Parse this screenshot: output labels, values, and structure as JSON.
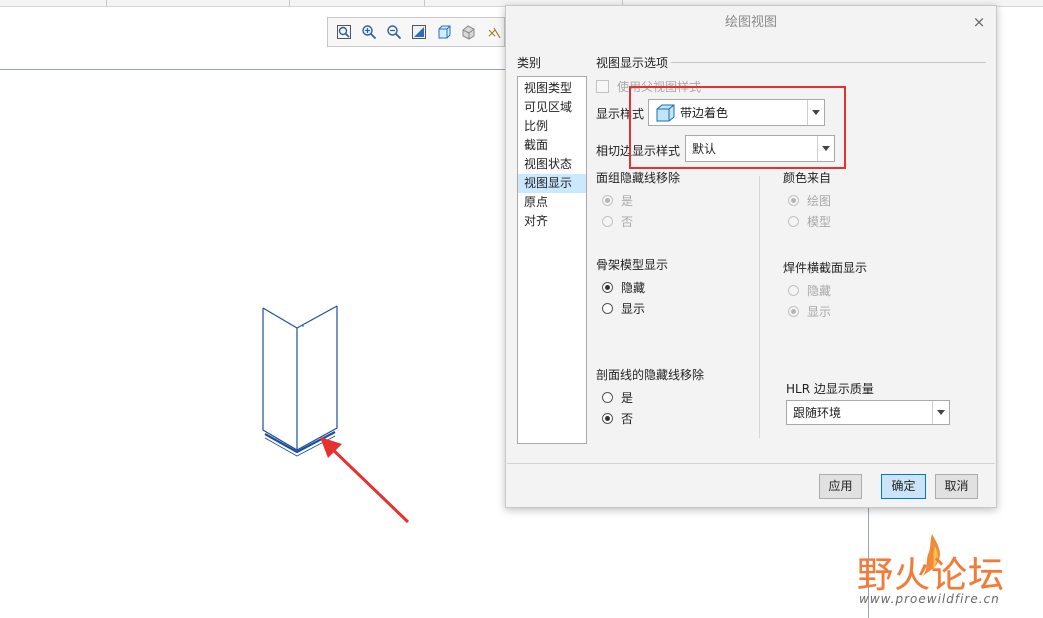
{
  "toolbar": {
    "icons": [
      "zoom-window-icon",
      "zoom-in-icon",
      "zoom-out-icon",
      "repaint-icon",
      "view-cube-icon",
      "display-style-icon",
      "datum-display-icon"
    ]
  },
  "dialog": {
    "title": "绘图视图",
    "category_label": "类别",
    "categories": [
      "视图类型",
      "可见区域",
      "比例",
      "截面",
      "视图状态",
      "视图显示",
      "原点",
      "对齐"
    ],
    "selected_category": "视图显示",
    "section_title": "视图显示选项",
    "use_parent_style": "使用父视图样式",
    "display_style_label": "显示样式",
    "display_style_value": "带边着色",
    "tangent_edge_label": "相切边显示样式",
    "tangent_edge_value": "默认",
    "face_group_label": "面组隐藏线移除",
    "face_group_yes": "是",
    "face_group_no": "否",
    "color_from_label": "颜色来自",
    "color_from_drawing": "绘图",
    "color_from_model": "模型",
    "skeleton_label": "骨架模型显示",
    "skeleton_hide": "隐藏",
    "skeleton_show": "显示",
    "weld_label": "焊件横截面显示",
    "weld_hide": "隐藏",
    "weld_show": "显示",
    "hatch_label": "剖面线的隐藏线移除",
    "hatch_yes": "是",
    "hatch_no": "否",
    "hlr_label": "HLR 边显示质量",
    "hlr_value": "跟随环境",
    "apply": "应用",
    "ok": "确定",
    "cancel": "取消",
    "close_glyph": "×"
  },
  "watermark": {
    "name": "野火论坛",
    "url": "www.proewildfire.cn"
  },
  "colors": {
    "highlight_box": "#e53130",
    "arrow": "#e53130",
    "model_edges": "#1f4f9a",
    "selected_category_bg": "#cce8ff"
  }
}
